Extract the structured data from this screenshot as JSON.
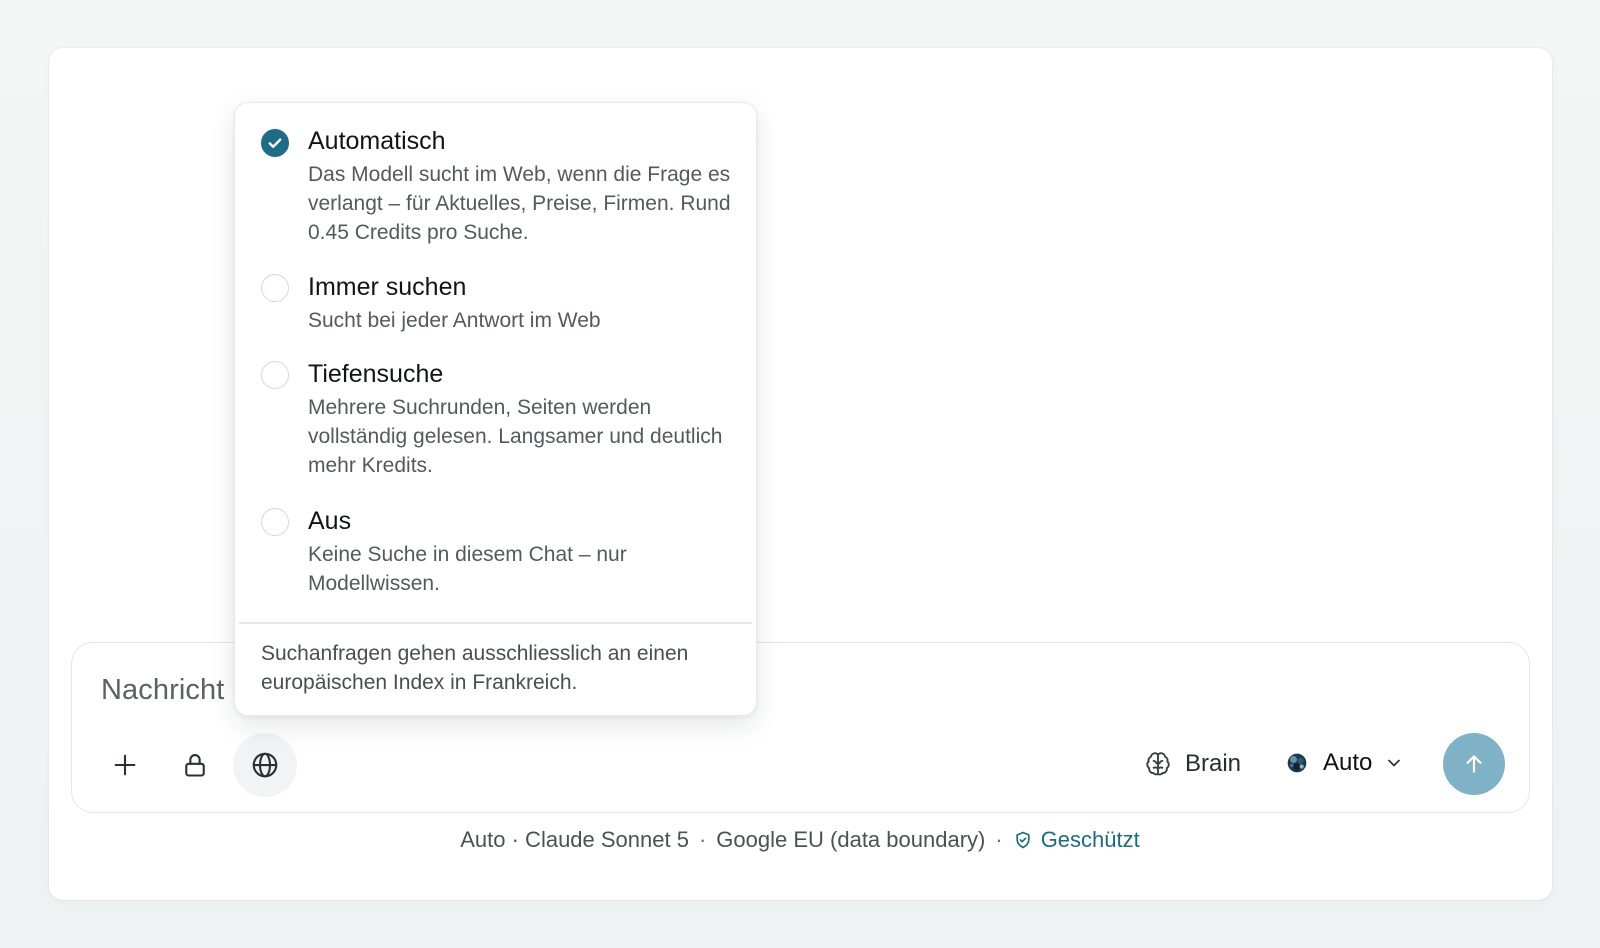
{
  "composer": {
    "placeholder": "Nachricht",
    "brain_label": "Brain",
    "model_label": "Auto"
  },
  "footer": {
    "model_info": "Auto · Claude Sonnet 5",
    "sep1": "·",
    "provider": "Google EU (data boundary)",
    "sep2": "·",
    "protected_label": "Geschützt"
  },
  "search_menu": {
    "options": [
      {
        "title": "Automatisch",
        "description": "Das Modell sucht im Web, wenn die Frage es verlangt – für Aktuelles, Preise, Firmen. Rund 0.45 Credits pro Suche.",
        "selected": true
      },
      {
        "title": "Immer suchen",
        "description": "Sucht bei jeder Antwort im Web",
        "selected": false
      },
      {
        "title": "Tiefensuche",
        "description": "Mehrere Suchrunden, Seiten werden vollständig gelesen. Langsamer und deutlich mehr Kredits.",
        "selected": false
      },
      {
        "title": "Aus",
        "description": "Keine Suche in diesem Chat – nur Modellwissen.",
        "selected": false
      }
    ],
    "note": "Suchanfragen gehen ausschliesslich an einen europäischen Index in Frankreich."
  },
  "icons": {
    "add": "plus-icon",
    "lock": "lock-icon",
    "web_search": "globe-icon",
    "brain": "brain-icon",
    "model": "model-logo-icon",
    "dropdown": "chevron-down-icon",
    "send": "arrow-up-icon",
    "protected": "shield-check-icon",
    "check": "check-icon"
  },
  "colors": {
    "accent": "#1e6c86",
    "send_button": "#7fb2c6",
    "protected_text": "#1d6a82"
  }
}
